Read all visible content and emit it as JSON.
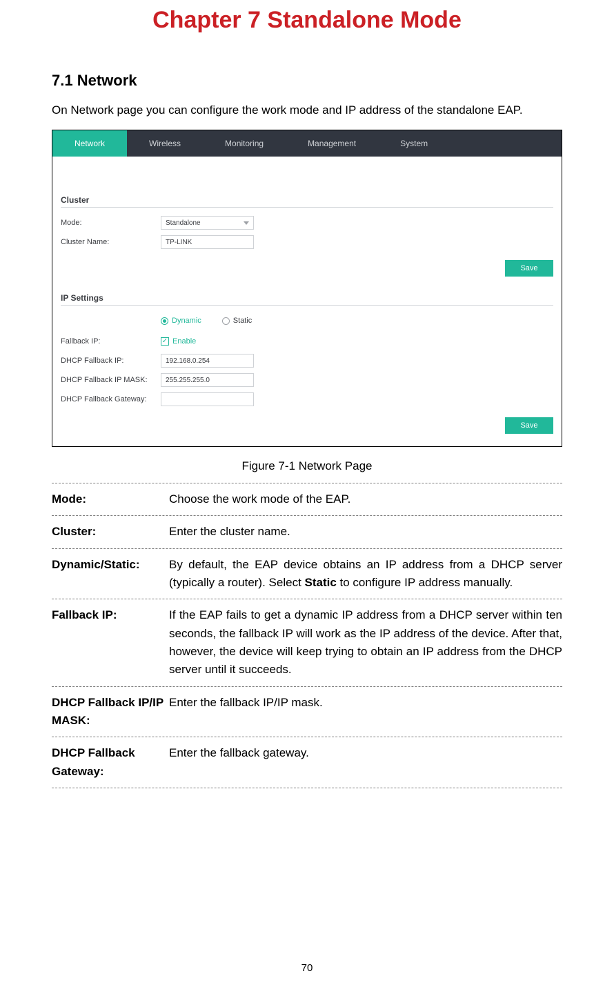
{
  "chapter_title": "Chapter 7  Standalone Mode",
  "section_heading": "7.1  Network",
  "intro_text": "On Network page you can configure the work mode and IP address of the standalone EAP.",
  "nav": {
    "items": [
      "Network",
      "Wireless",
      "Monitoring",
      "Management",
      "System"
    ],
    "active_index": 0
  },
  "screenshot": {
    "cluster": {
      "title": "Cluster",
      "mode_label": "Mode:",
      "mode_value": "Standalone",
      "cluster_name_label": "Cluster Name:",
      "cluster_name_value": "TP-LINK",
      "save_label": "Save"
    },
    "ip_settings": {
      "title": "IP Settings",
      "radio_dynamic": "Dynamic",
      "radio_static": "Static",
      "radio_selected": "Dynamic",
      "fallback_ip_label": "Fallback IP:",
      "fallback_enable_label": "Enable",
      "fallback_enable_checked": true,
      "dhcp_fallback_ip_label": "DHCP Fallback IP:",
      "dhcp_fallback_ip_value": "192.168.0.254",
      "dhcp_fallback_mask_label": "DHCP Fallback IP MASK:",
      "dhcp_fallback_mask_value": "255.255.255.0",
      "dhcp_fallback_gw_label": "DHCP Fallback Gateway:",
      "dhcp_fallback_gw_value": "",
      "save_label": "Save"
    }
  },
  "figure_caption": "Figure 7-1 Network Page",
  "definitions": [
    {
      "term": "Mode:",
      "desc": "Choose the work mode of the EAP."
    },
    {
      "term": "Cluster:",
      "desc": "Enter the cluster name."
    },
    {
      "term": "Dynamic/Static:",
      "desc_pre": "By default, the EAP device obtains an IP address from a DHCP server (typically a router). Select ",
      "desc_bold": "Static",
      "desc_post": " to configure IP address manually."
    },
    {
      "term": "Fallback IP:",
      "desc": "If the EAP fails to get a dynamic IP address from a DHCP server within ten seconds, the fallback IP will work as the IP address of the device. After that, however, the device will keep trying to obtain an IP address from the DHCP server until it succeeds."
    },
    {
      "term": "DHCP Fallback IP/IP MASK:",
      "desc": "Enter the fallback IP/IP mask."
    },
    {
      "term": "DHCP Fallback Gateway:",
      "desc": "Enter the fallback gateway."
    }
  ],
  "page_number": "70"
}
